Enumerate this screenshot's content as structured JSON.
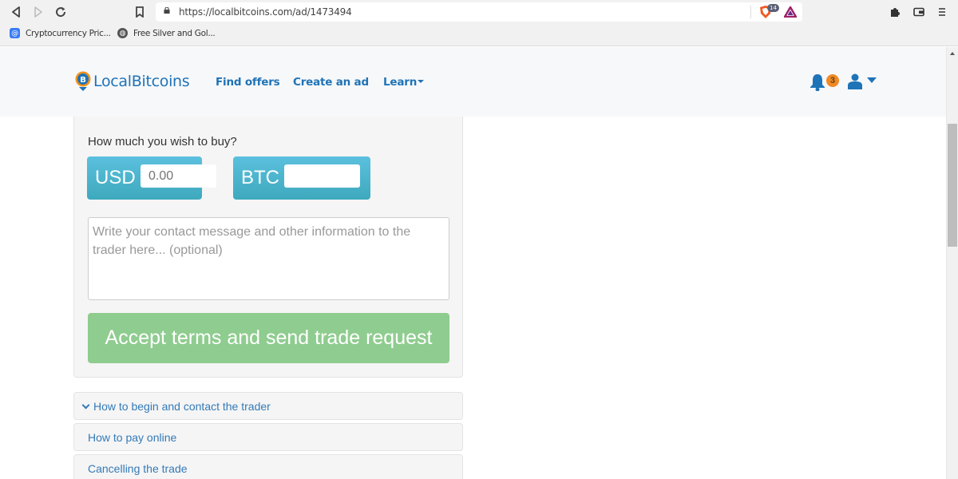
{
  "browser": {
    "url": "https://localbitcoins.com/ad/1473494",
    "brave_shield_count": "14",
    "bookmarks": [
      {
        "label": "Cryptocurrency Pric...",
        "icon": "at-icon"
      },
      {
        "label": "Free Silver and Gol...",
        "icon": "globe-icon"
      }
    ]
  },
  "navbar": {
    "brand": "LocalBitcoins",
    "links": [
      "Find offers",
      "Create an ad",
      "Learn"
    ],
    "notification_count": "3"
  },
  "trade_form": {
    "question": "How much you wish to buy?",
    "fiat_currency": "USD",
    "fiat_placeholder": "0.00",
    "fiat_value": "",
    "crypto_currency": "BTC",
    "crypto_value": "",
    "message_placeholder": "Write your contact message and other information to the trader here... (optional)",
    "submit_label": "Accept terms and send trade request"
  },
  "colors": {
    "brand_blue": "#1f73b7",
    "currency_box": "#5bc0de",
    "accept_button": "#8fcc8f",
    "badge": "#f08a24"
  },
  "accordion": [
    {
      "label": "How to begin and contact the trader",
      "expanded": true
    },
    {
      "label": "How to pay online",
      "expanded": false
    },
    {
      "label": "Cancelling the trade",
      "expanded": false
    }
  ]
}
